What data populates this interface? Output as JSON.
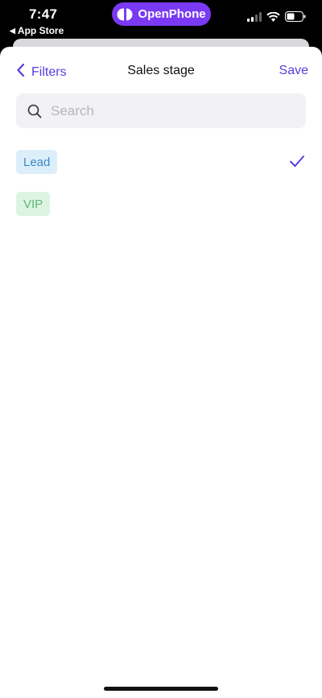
{
  "status_bar": {
    "time": "7:47",
    "back_app": "App Store",
    "app_pill": "OpenPhone"
  },
  "nav": {
    "back_label": "Filters",
    "title": "Sales stage",
    "save_label": "Save"
  },
  "search": {
    "placeholder": "Search",
    "value": ""
  },
  "options": [
    {
      "label": "Lead",
      "selected": true,
      "bg": "#ddeefb",
      "fg": "#3b88c9"
    },
    {
      "label": "VIP",
      "selected": false,
      "bg": "#def4e2",
      "fg": "#5fb879"
    }
  ],
  "colors": {
    "accent": "#5b3be0",
    "pill": "#7a3af3"
  }
}
